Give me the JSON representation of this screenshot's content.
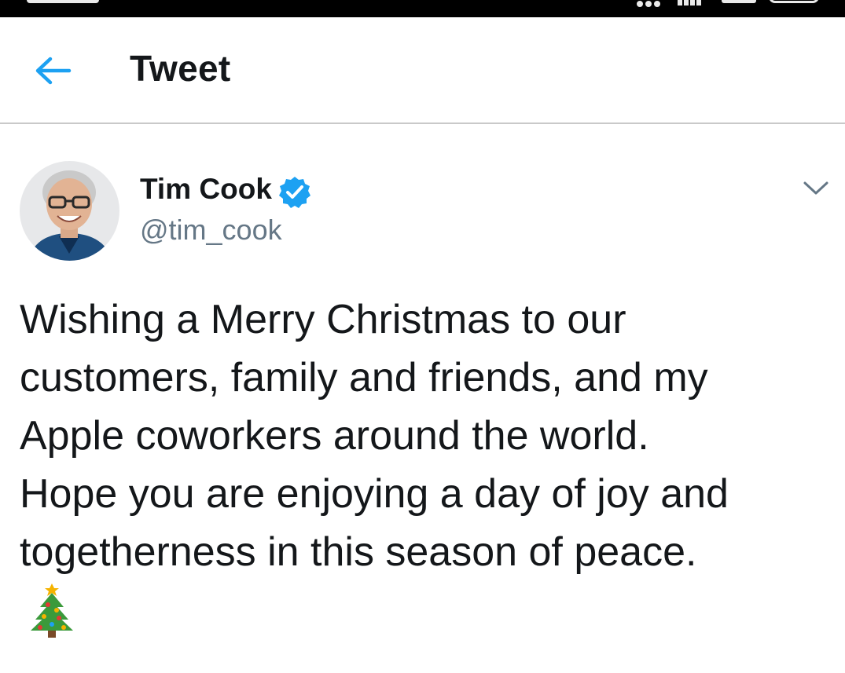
{
  "header": {
    "title": "Tweet",
    "back_icon": "arrow-left-icon"
  },
  "tweet": {
    "author": {
      "display_name": "Tim Cook",
      "handle": "@tim_cook",
      "verified": true,
      "verified_icon": "verified-badge-icon"
    },
    "text_lines": [
      "Wishing a Merry Christmas to our",
      "customers, family and friends, and my",
      "Apple coworkers around the world.",
      "Hope you are enjoying a day of joy and",
      "togetherness in this season of peace."
    ],
    "emoji": "christmas-tree-icon",
    "menu_icon": "chevron-down-icon"
  },
  "colors": {
    "accent": "#1da1f2",
    "text_primary": "#14171a",
    "text_secondary": "#657786",
    "divider": "#c9c9c9",
    "status_bar": "#000000"
  }
}
